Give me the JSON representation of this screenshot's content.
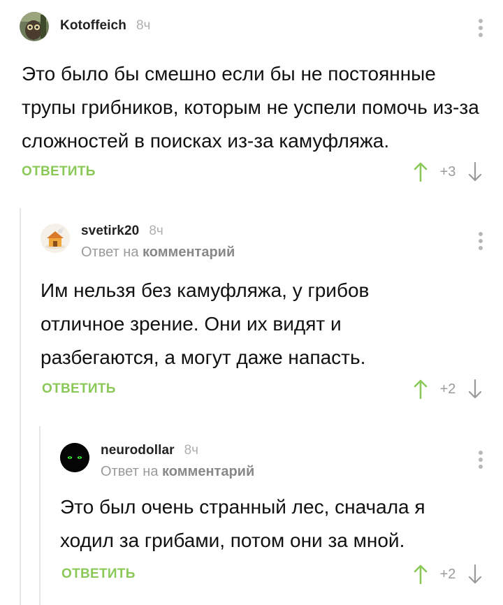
{
  "colors": {
    "accent_green": "#8ac858",
    "muted": "#9a9a9a",
    "thread_line": "#e6e6e6"
  },
  "comments": [
    {
      "username": "Kotoffeich",
      "time": "8ч",
      "avatar_icon": "owl-photo-avatar",
      "text": "Это было бы смешно если бы не постоянные трупы грибников, которым не успели помочь из-за сложностей в поисках из-за камуфляжа.",
      "reply_label": "ОТВЕТИТЬ",
      "score": "+3"
    },
    {
      "username": "svetirk20",
      "time": "8ч",
      "avatar_icon": "house-avatar",
      "reply_to_prefix": "Ответ на",
      "reply_to_link": "комментарий",
      "text": "Им нельзя без камуфляжа, у грибов отличное зрение. Они их видят и разбегаются, а могут даже напасть.",
      "reply_label": "ОТВЕТИТЬ",
      "score": "+2"
    },
    {
      "username": "neurodollar",
      "time": "8ч",
      "avatar_icon": "glowing-eyes-avatar",
      "reply_to_prefix": "Ответ на",
      "reply_to_link": "комментарий",
      "text": "Это был очень странный лес, сначала я ходил за грибами, потом они за мной.",
      "reply_label": "ОТВЕТИТЬ",
      "score": "+2"
    }
  ]
}
